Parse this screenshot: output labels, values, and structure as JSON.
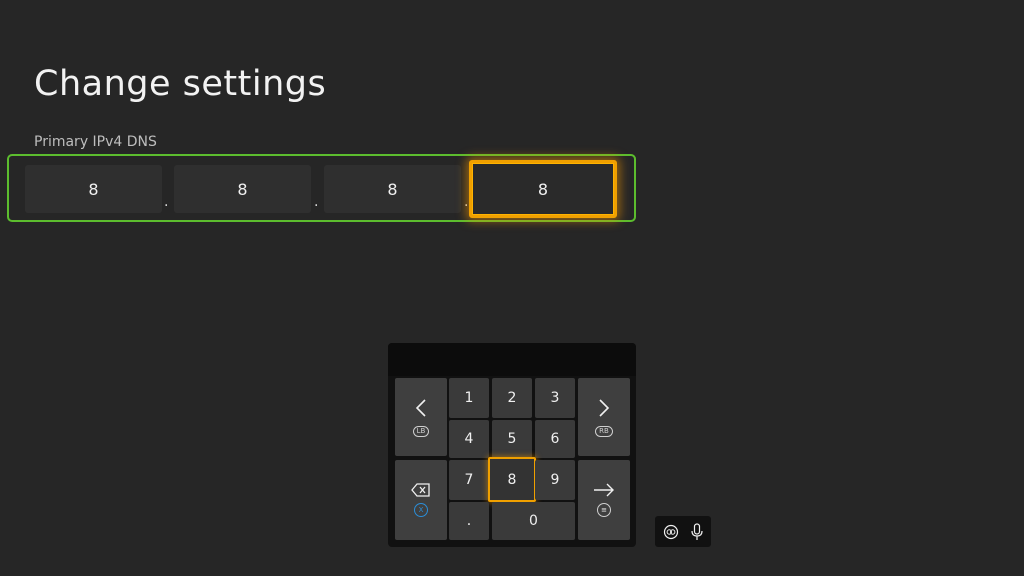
{
  "page": {
    "title": "Change settings"
  },
  "dns_field": {
    "label": "Primary IPv4 DNS",
    "octets": [
      "8",
      "8",
      "8",
      "8"
    ],
    "separator": "."
  },
  "keypad": {
    "digits": [
      "1",
      "2",
      "3",
      "4",
      "5",
      "6",
      "7",
      "8",
      "9",
      "0"
    ],
    "dot": ".",
    "left_label": "LB",
    "right_label": "RB",
    "backspace_hint": "X",
    "enter_hint": "≡",
    "focused_key": "8"
  },
  "colors": {
    "accent_green": "#5cbd2e",
    "focus_orange": "#f0a000",
    "hint_blue": "#2b8ed8"
  }
}
